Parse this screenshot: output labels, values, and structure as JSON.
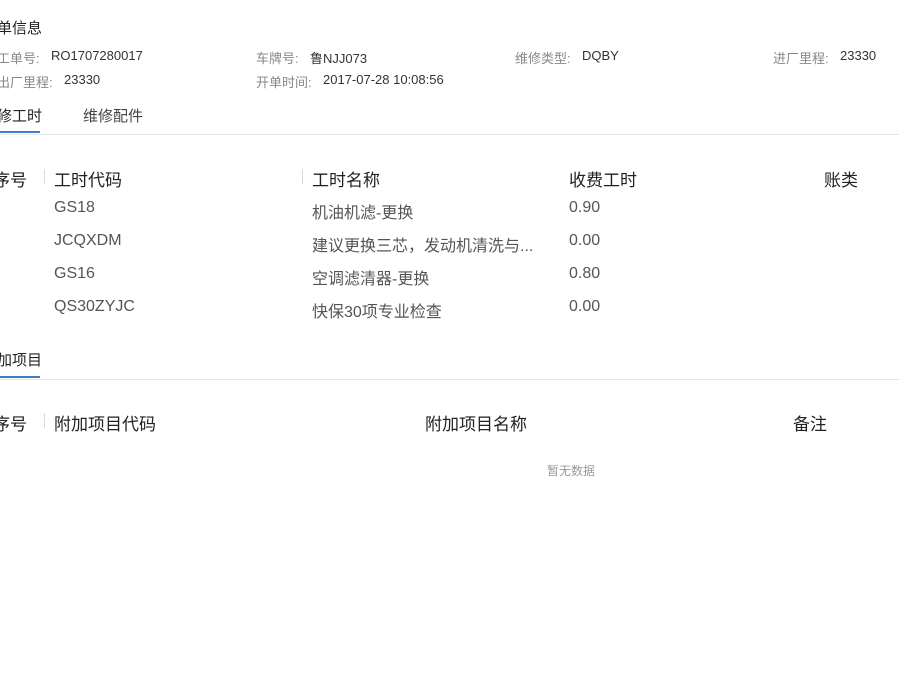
{
  "order_info": {
    "title": "单信息",
    "fields": [
      {
        "label": "工单号:",
        "value": "RO1707280017"
      },
      {
        "label": "车牌号:",
        "value": "鲁NJJ073"
      },
      {
        "label": "维修类型:",
        "value": "DQBY"
      },
      {
        "label": "进厂里程:",
        "value": "23330"
      },
      {
        "label": "出厂里程:",
        "value": "23330"
      },
      {
        "label": "开单时间:",
        "value": "2017-07-28 10:08:56"
      }
    ]
  },
  "tabs": [
    {
      "label": "修工时",
      "active": true
    },
    {
      "label": "维修配件",
      "active": false
    }
  ],
  "labor_table": {
    "headers": [
      "序号",
      "工时代码",
      "工时名称",
      "收费工时",
      "账类"
    ],
    "rows": [
      {
        "code": "GS18",
        "name": "机油机滤-更换",
        "hours": "0.90"
      },
      {
        "code": "JCQXDM",
        "name": "建议更换三芯，发动机清洗与...",
        "hours": "0.00"
      },
      {
        "code": "GS16",
        "name": "空调滤清器-更换",
        "hours": "0.80"
      },
      {
        "code": "QS30ZYJC",
        "name": "快保30项专业检查",
        "hours": "0.00"
      }
    ]
  },
  "extra_section": {
    "tab_label": "加项目",
    "headers": [
      "序号",
      "附加项目代码",
      "附加项目名称",
      "备注"
    ],
    "empty_text": "暂无数据"
  },
  "colors": {
    "accent": "#3c7fc9"
  }
}
